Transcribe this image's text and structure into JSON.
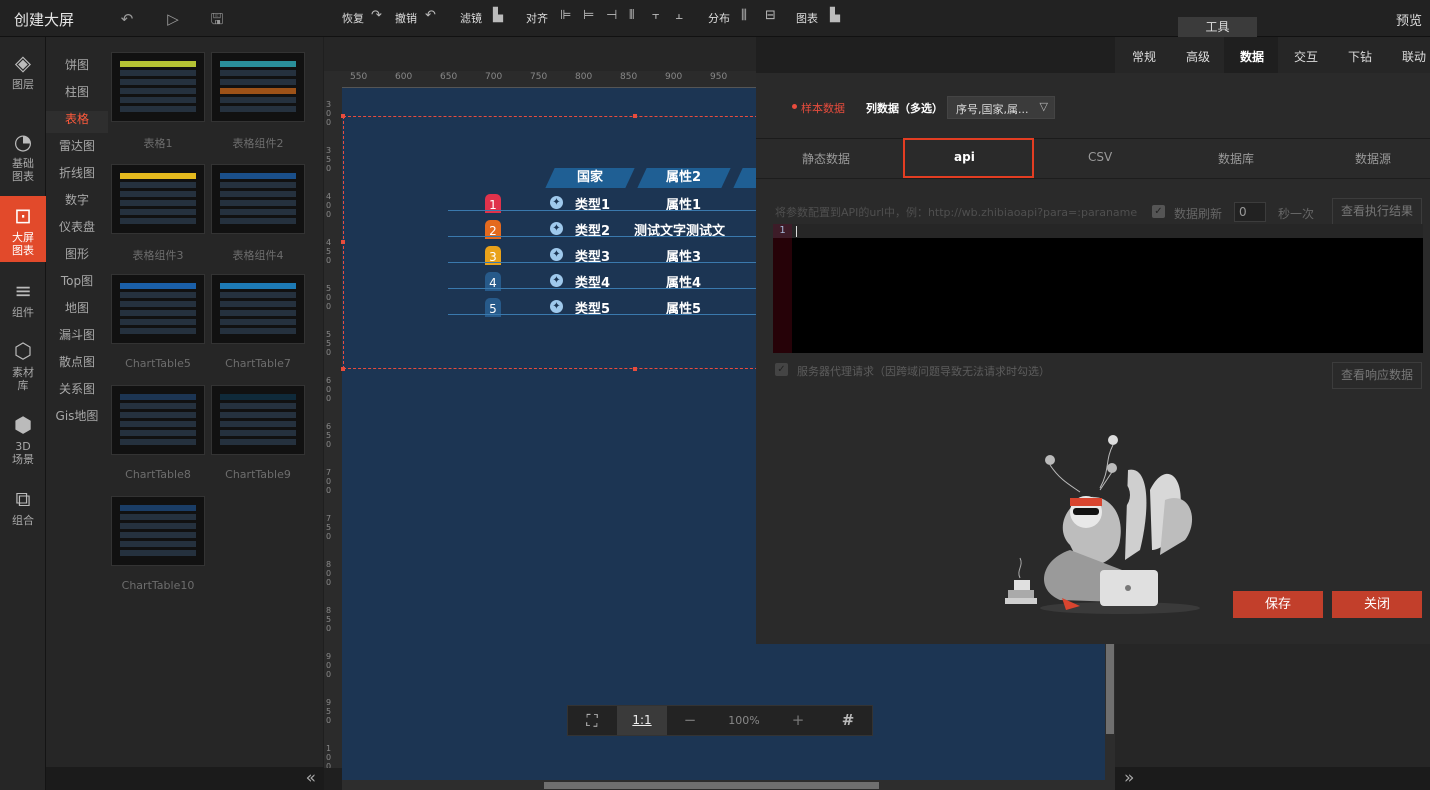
{
  "app": {
    "title": "创建大屏",
    "preview": "预览",
    "tool_tab": "工具"
  },
  "leftnav": [
    {
      "label1": "图层",
      "label2": "",
      "icon": "layers-icon",
      "glyph": "◈"
    },
    {
      "label1": "基础",
      "label2": "图表",
      "icon": "pie-chart-icon",
      "glyph": "◔"
    },
    {
      "label1": "大屏",
      "label2": "图表",
      "icon": "screen-chart-icon",
      "glyph": "⊡"
    },
    {
      "label1": "组件",
      "label2": "",
      "icon": "sliders-icon",
      "glyph": "≡"
    },
    {
      "label1": "素材",
      "label2": "库",
      "icon": "hexagons-icon",
      "glyph": "⬡"
    },
    {
      "label1": "3D",
      "label2": "场景",
      "icon": "cube-icon",
      "glyph": "⬢"
    },
    {
      "label1": "组合",
      "label2": "",
      "icon": "group-icon",
      "glyph": "⧉"
    }
  ],
  "categories": [
    "饼图",
    "柱图",
    "表格",
    "雷达图",
    "折线图",
    "数字",
    "仪表盘",
    "图形",
    "Top图",
    "地图",
    "漏斗图",
    "散点图",
    "关系图",
    "Gis地图"
  ],
  "thumbnails": [
    "表格1",
    "表格组件2",
    "表格组件3",
    "表格组件4",
    "ChartTable5",
    "ChartTable7",
    "ChartTable8",
    "ChartTable9",
    "ChartTable10"
  ],
  "toolbar": {
    "restore": "恢复",
    "undo": "撤销",
    "filter": "滤镜",
    "align": "对齐",
    "distribute": "分布",
    "chart": "图表"
  },
  "ruler_top": [
    "550",
    "600",
    "650",
    "700",
    "750",
    "800",
    "850",
    "900",
    "950"
  ],
  "ruler_left": [
    {
      "d": [
        "3",
        "0",
        "0"
      ]
    },
    {
      "d": [
        "3",
        "5",
        "0"
      ]
    },
    {
      "d": [
        "4",
        "0",
        "0"
      ]
    },
    {
      "d": [
        "4",
        "5",
        "0"
      ]
    },
    {
      "d": [
        "5",
        "0",
        "0"
      ]
    },
    {
      "d": [
        "5",
        "5",
        "0"
      ]
    },
    {
      "d": [
        "6",
        "0",
        "0"
      ]
    },
    {
      "d": [
        "6",
        "5",
        "0"
      ]
    },
    {
      "d": [
        "7",
        "0",
        "0"
      ]
    },
    {
      "d": [
        "7",
        "5",
        "0"
      ]
    },
    {
      "d": [
        "8",
        "0",
        "0"
      ]
    },
    {
      "d": [
        "8",
        "5",
        "0"
      ]
    },
    {
      "d": [
        "9",
        "0",
        "0"
      ]
    },
    {
      "d": [
        "9",
        "5",
        "0"
      ]
    },
    {
      "d": [
        "1",
        "0",
        "0",
        "0"
      ]
    }
  ],
  "table": {
    "headers": [
      "国家",
      "属性2"
    ],
    "rows": [
      {
        "rank": "1",
        "type": "类型1",
        "attr": "属性1",
        "color": "#e0324b"
      },
      {
        "rank": "2",
        "type": "类型2",
        "attr": "测试文字测试文",
        "color": "#e46a1e"
      },
      {
        "rank": "3",
        "type": "类型3",
        "attr": "属性3",
        "color": "#e9a21a"
      },
      {
        "rank": "4",
        "type": "类型4",
        "attr": "属性4",
        "color": "#275a8a"
      },
      {
        "rank": "5",
        "type": "类型5",
        "attr": "属性5",
        "color": "#275a8a"
      }
    ]
  },
  "zoom": {
    "fit_label": "⛶",
    "one_to_one": "1:1",
    "minus": "−",
    "percent": "100%",
    "plus": "+",
    "grid_label": "#"
  },
  "right_tabs": [
    "常规",
    "高级",
    "数据",
    "交互",
    "下钻",
    "联动"
  ],
  "dialog": {
    "sample_data": "样本数据",
    "col_data_label": "列数据（多选）",
    "col_data_value": "序号,国家,属...",
    "source_tabs": [
      "静态数据",
      "api",
      "CSV",
      "数据库",
      "数据源"
    ],
    "api_placeholder": "将参数配置到API的url中，例：http://wb.zhibiaoapi?para=:paraname",
    "refresh_label": "数据刷新",
    "refresh_value": "0",
    "refresh_unit": "秒一次",
    "view_result": "查看执行结果",
    "line_no": "1",
    "proxy_label": "服务器代理请求（因跨域问题导致无法请求时勾选）",
    "view_response": "查看响应数据",
    "save": "保存",
    "close": "关闭"
  }
}
